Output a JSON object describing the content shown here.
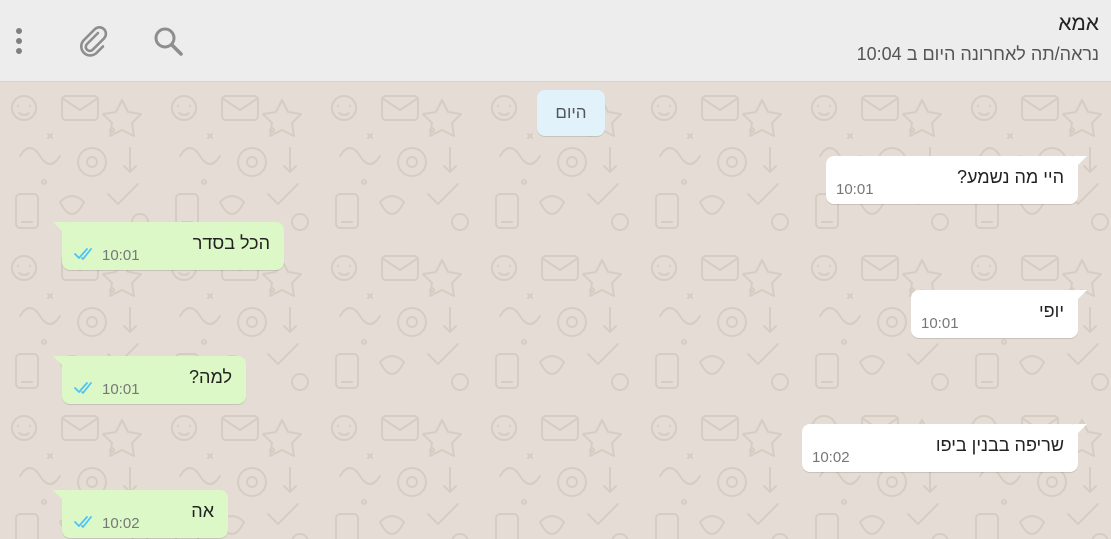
{
  "header": {
    "contact_name": "אמא",
    "status": "נראה/תה לאחרונה היום ב 10:04",
    "icons": [
      "menu-dots-icon",
      "paperclip-icon",
      "search-icon"
    ]
  },
  "chat": {
    "day_separator": "היום",
    "messages": [
      {
        "direction": "incoming",
        "text": "היי מה נשמע?",
        "time": "10:01"
      },
      {
        "direction": "outgoing",
        "text": "הכל בסדר",
        "time": "10:01",
        "status": "read"
      },
      {
        "direction": "incoming",
        "text": "יופי",
        "time": "10:01"
      },
      {
        "direction": "outgoing",
        "text": "למה?",
        "time": "10:01",
        "status": "read"
      },
      {
        "direction": "incoming",
        "text": "שריפה בבנין ביפו",
        "time": "10:02"
      },
      {
        "direction": "outgoing",
        "text": "אה",
        "time": "10:02",
        "status": "read"
      }
    ]
  },
  "colors": {
    "header_bg": "#ededed",
    "chat_bg": "#e5ddd5",
    "incoming_bubble": "#ffffff",
    "outgoing_bubble": "#dcf8c6",
    "day_chip": "#e1f2fb",
    "read_ticks": "#4fc3f7",
    "icon_gray": "#9a9a9a"
  }
}
